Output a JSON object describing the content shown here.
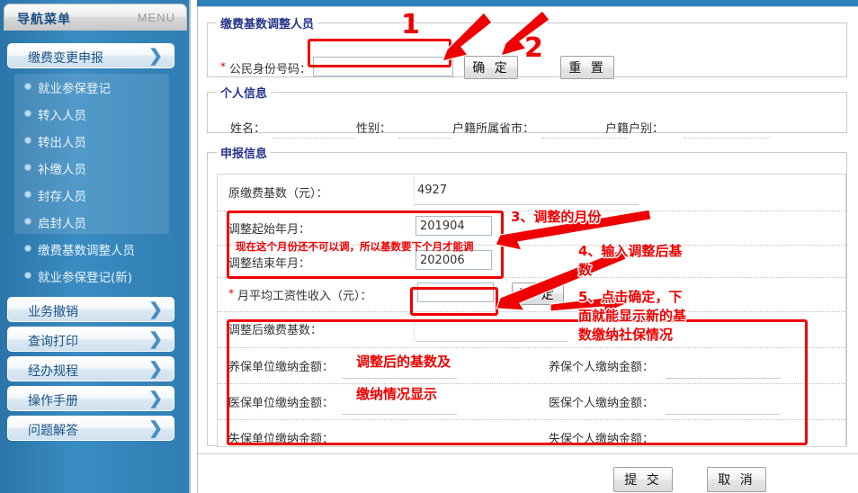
{
  "sidebar": {
    "header": {
      "title": "导航菜单",
      "menu": "MENU"
    },
    "top_button": {
      "label": "缴费变更申报",
      "chevron": "chevron-right-icon"
    },
    "submenu_items": [
      {
        "label": "就业参保登记"
      },
      {
        "label": "转入人员"
      },
      {
        "label": "转出人员"
      },
      {
        "label": "补缴人员"
      },
      {
        "label": "封存人员"
      },
      {
        "label": "启封人员"
      },
      {
        "label": "缴费基数调整人员"
      },
      {
        "label": "就业参保登记(新)"
      }
    ],
    "nav_buttons": [
      {
        "label": "业务撤销"
      },
      {
        "label": "查询打印"
      },
      {
        "label": "经办规程"
      },
      {
        "label": "操作手册"
      },
      {
        "label": "问题解答"
      }
    ]
  },
  "search_section": {
    "legend": "缴费基数调整人员",
    "id_label": "公民身份号码：",
    "id_required": "*",
    "id_value": "",
    "confirm_label": "确 定",
    "reset_label": "重 置"
  },
  "personal_section": {
    "legend": "个人信息",
    "fields": [
      {
        "label": "姓名：",
        "value": ""
      },
      {
        "label": "性别：",
        "value": ""
      },
      {
        "label": "户籍所属省市：",
        "value": ""
      },
      {
        "label": "户籍户别：",
        "value": ""
      }
    ]
  },
  "declaration_section": {
    "legend": "申报信息",
    "original_base_label": "原缴费基数（元）：",
    "original_base_value": "4927",
    "start_month_label": "调整起始年月：",
    "start_month_value": "201904",
    "end_month_label": "调整结束年月：",
    "end_month_value": "202006",
    "avg_wage_required": "*",
    "avg_wage_label": "月平均工资性收入（元）：",
    "avg_wage_value": "",
    "avg_wage_confirm_label": "确 定",
    "adjusted_base_label": "调整后缴费基数：",
    "adjusted_base_value": "",
    "amount_rows": [
      {
        "left_label": "养保单位缴纳金额：",
        "left_value": "",
        "right_label": "养保个人缴纳金额：",
        "right_value": ""
      },
      {
        "left_label": "医保单位缴纳金额：",
        "left_value": "",
        "right_label": "医保个人缴纳金额：",
        "right_value": ""
      },
      {
        "left_label": "失保单位缴纳金额：",
        "left_value": "",
        "right_label": "失保个人缴纳金额：",
        "right_value": ""
      }
    ]
  },
  "footer": {
    "submit_label": "提 交",
    "cancel_label": "取 消"
  },
  "annotations": {
    "num1": "1",
    "num2": "2",
    "step3": "3、调整的月份",
    "step4_line1": "4、输入调整后基",
    "step4_line2": "数",
    "step5_line1": "5、点击确定，下",
    "step5_line2": "面就能显示新的基",
    "step5_line3": "数缴纳社保情况",
    "inline_note": "现在这个月份还不可以调，所以基数要下个月才能调",
    "result_note_line1": "调整后的基数及",
    "result_note_line2": "缴纳情况显示",
    "color": "#ee0000"
  }
}
